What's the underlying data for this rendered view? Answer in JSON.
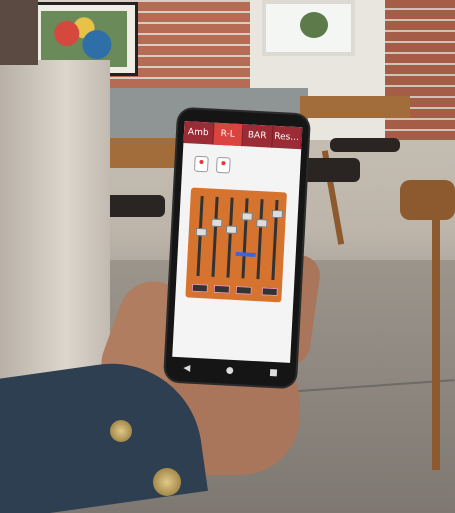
{
  "phone_app": {
    "tabs": [
      {
        "label": "Amb"
      },
      {
        "label": "R-L"
      },
      {
        "label": "BAR"
      },
      {
        "label": "Res..."
      }
    ],
    "active_tab": 1
  },
  "colors": {
    "tab_bar": "#9b2b34",
    "active_tab": "#d9443f",
    "mixer_panel": "#d6742f",
    "level_bar": "#3b66d8"
  },
  "icons": [
    "back-icon",
    "home-icon",
    "recents-icon"
  ]
}
